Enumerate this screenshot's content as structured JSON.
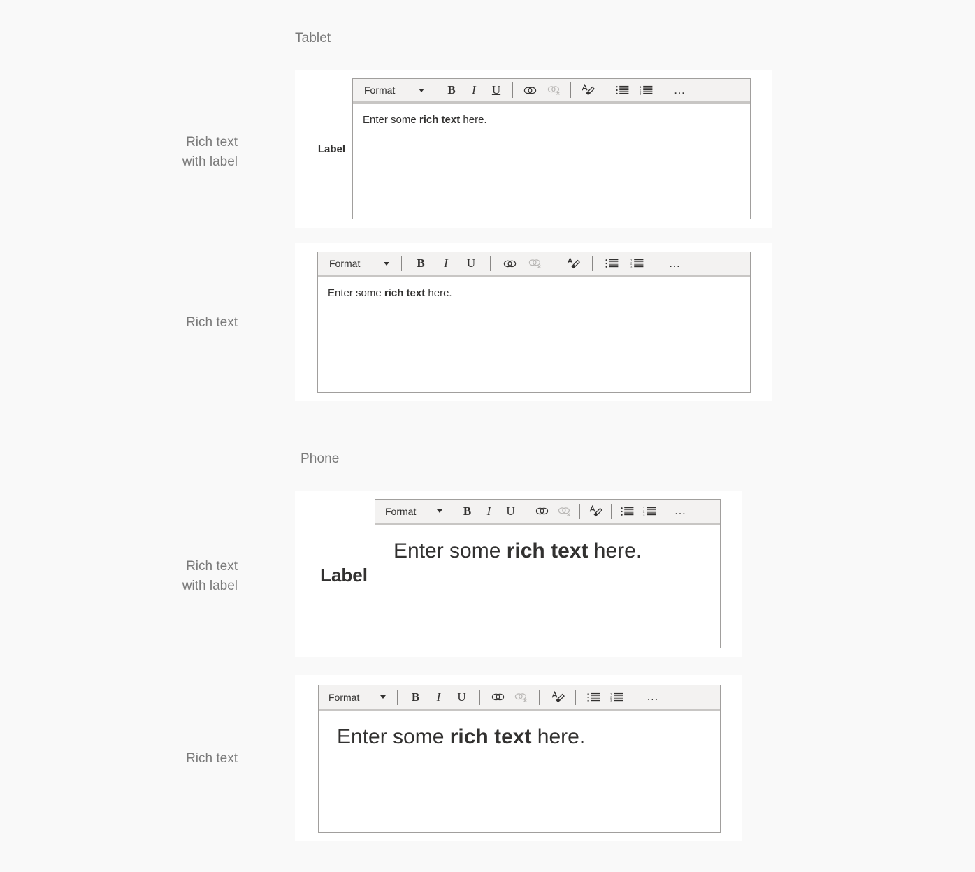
{
  "page": {
    "background": "#f9f9f9",
    "card_background": "#ffffff",
    "toolbar_background": "#f3f2f1",
    "toolbar_rule_color": "#c8c6c4",
    "border_color": "#a19f9d",
    "muted_text_color": "#7a7a7a",
    "text_color": "#323130",
    "disabled_icon_color": "#b9b7b5"
  },
  "sections": [
    {
      "id": "tablet",
      "title": "Tablet"
    },
    {
      "id": "phone",
      "title": "Phone"
    }
  ],
  "row_labels": {
    "rich_text_with_label": "Rich text\nwith label",
    "rich_text": "Rich text"
  },
  "toolbar": {
    "format_label": "Format",
    "chevron_icon": "chevron-down-icon",
    "buttons": [
      {
        "name": "bold-button",
        "glyph": "B",
        "label": "Bold",
        "disabled": false
      },
      {
        "name": "italic-button",
        "glyph": "I",
        "label": "Italic",
        "disabled": false
      },
      {
        "name": "underline-button",
        "glyph": "U",
        "label": "Underline",
        "disabled": false
      },
      {
        "name": "link-button",
        "glyph": "",
        "label": "Insert link",
        "disabled": false
      },
      {
        "name": "unlink-button",
        "glyph": "",
        "label": "Remove link",
        "disabled": true
      },
      {
        "name": "clear-formatting-button",
        "glyph": "",
        "label": "Clear formatting",
        "disabled": false
      },
      {
        "name": "bulleted-list-button",
        "glyph": "",
        "label": "Bulleted list",
        "disabled": false
      },
      {
        "name": "numbered-list-button",
        "glyph": "",
        "label": "Numbered list",
        "disabled": false
      },
      {
        "name": "more-options-button",
        "glyph": "…",
        "label": "More options",
        "disabled": false
      }
    ]
  },
  "examples": {
    "tablet_with_label": {
      "field_label": "Label",
      "body_prefix": "Enter some ",
      "body_bold": "rich text",
      "body_suffix": " here."
    },
    "tablet_plain": {
      "body_prefix": "Enter some ",
      "body_bold": "rich text",
      "body_suffix": " here."
    },
    "phone_with_label": {
      "field_label": "Label",
      "body_prefix": "Enter some ",
      "body_bold": "rich text",
      "body_suffix": " here."
    },
    "phone_plain": {
      "body_prefix": "Enter some ",
      "body_bold": "rich text",
      "body_suffix": " here."
    }
  }
}
